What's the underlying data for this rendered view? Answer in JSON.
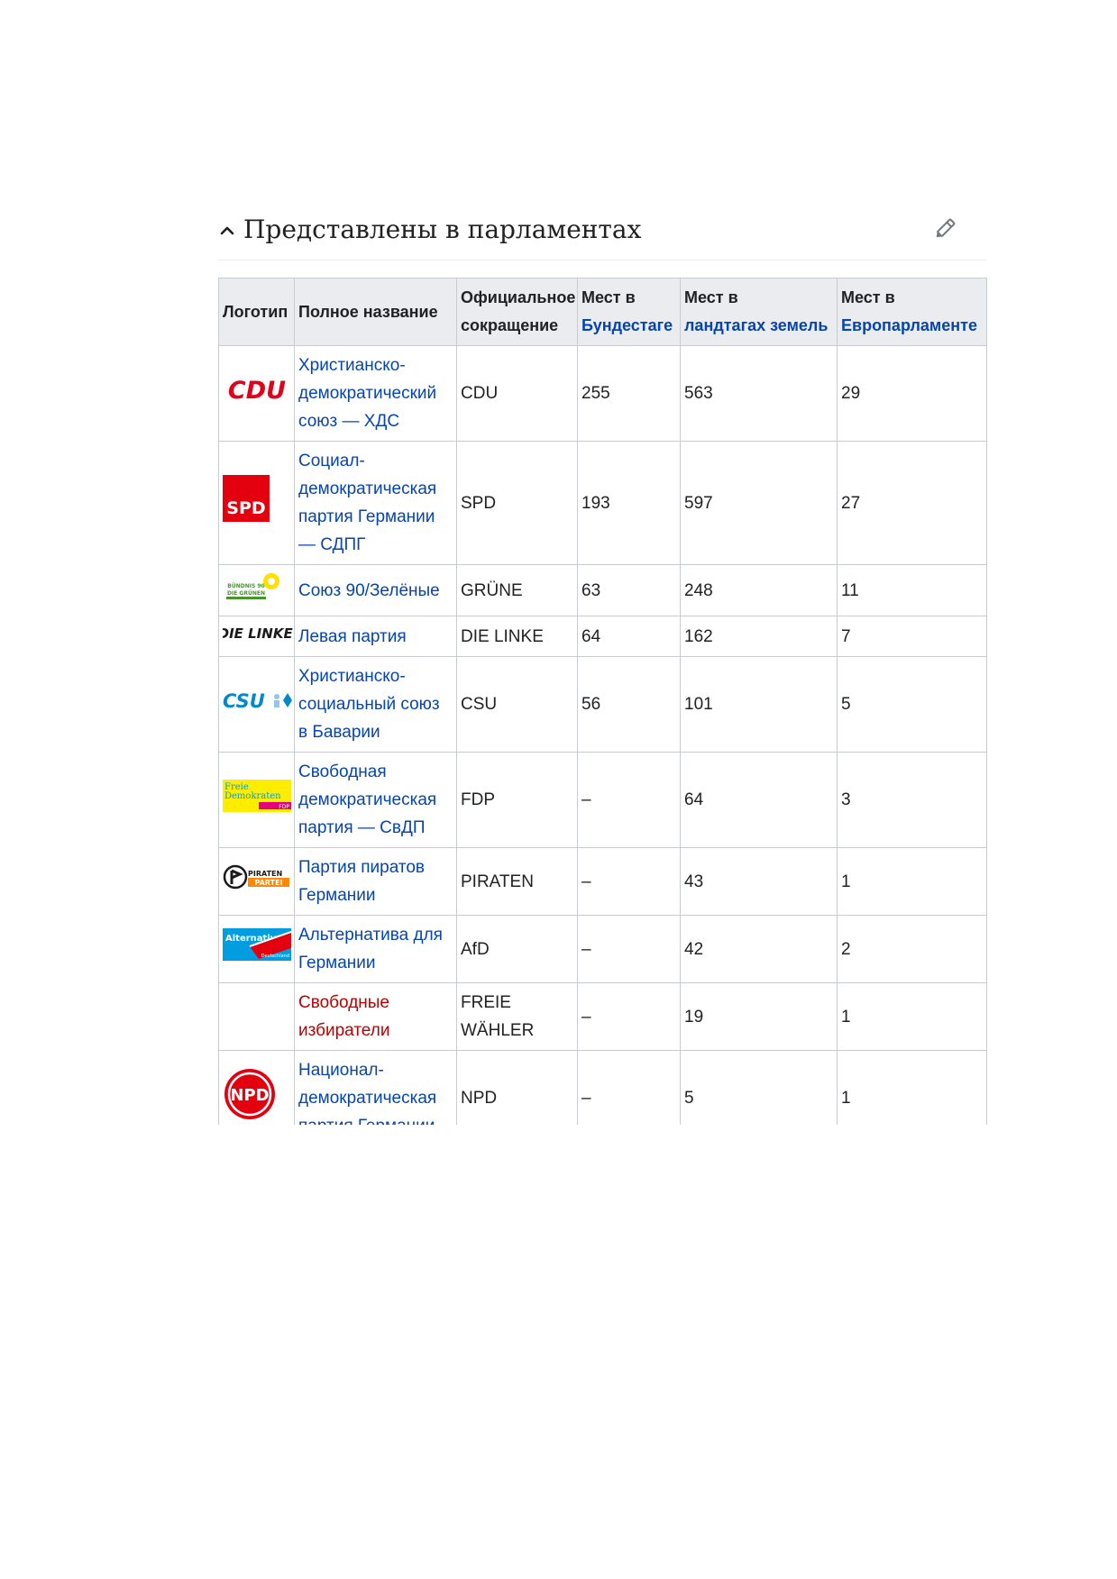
{
  "section": {
    "title": "Представлены в парламентах"
  },
  "table": {
    "headers": {
      "logo": "Логотип",
      "full_name": "Полное название",
      "abbr_line1": "Официальное",
      "abbr_line2": "сокращение",
      "bundestag_line1": "Мест в",
      "bundestag_line2": "Бундестаге",
      "landtag_line1": "Мест в",
      "landtag_line2": "ландтагах земель",
      "europarl_line1": "Мест в",
      "europarl_line2": "Европарламенте"
    },
    "rows": [
      {
        "logo_text": "CDU",
        "name": "Христианско-демократический союз — ХДС",
        "abbr": "CDU",
        "bundestag": "255",
        "landtag": "563",
        "europarl": "29"
      },
      {
        "logo_text": "SPD",
        "name": "Социал-демократическая партия Германии — СДПГ",
        "abbr": "SPD",
        "bundestag": "193",
        "landtag": "597",
        "europarl": "27"
      },
      {
        "logo_text": "BÜNDNIS 90 DIE GRÜNEN",
        "name": "Союз 90/Зелёные",
        "abbr": "GRÜNE",
        "bundestag": "63",
        "landtag": "248",
        "europarl": "11"
      },
      {
        "logo_text": "DIE LINKE.",
        "name": "Левая партия",
        "abbr": "DIE LINKE",
        "bundestag": "64",
        "landtag": "162",
        "europarl": "7"
      },
      {
        "logo_text": "CSU",
        "name": "Христианско-социальный союз в Баварии",
        "abbr": "CSU",
        "bundestag": "56",
        "landtag": "101",
        "europarl": "5"
      },
      {
        "logo_text": "Freie Demokraten FDP",
        "name": "Свободная демократическая партия — СвДП",
        "abbr": "FDP",
        "bundestag": "–",
        "landtag": "64",
        "europarl": "3"
      },
      {
        "logo_text": "PIRATEN PARTEI",
        "name": "Партия пиратов Германии",
        "abbr": "PIRATEN",
        "bundestag": "–",
        "landtag": "43",
        "europarl": "1"
      },
      {
        "logo_text": "Alternative für Deutschland",
        "name": "Альтернатива для Германии",
        "abbr": "AfD",
        "bundestag": "–",
        "landtag": "42",
        "europarl": "2"
      },
      {
        "logo_text": "",
        "name": "Свободные избиратели",
        "abbr": "FREIE WÄHLER",
        "bundestag": "–",
        "landtag": "19",
        "europarl": "1"
      },
      {
        "logo_text": "NPD",
        "name": "Национал-демократическая партия Германии",
        "abbr": "NPD",
        "bundestag": "–",
        "landtag": "5",
        "europarl": "1"
      }
    ]
  },
  "colors": {
    "link": "#0645ad",
    "redlink": "#ba0000",
    "header_bg": "#eaecf0",
    "border": "#c8ccd1"
  }
}
